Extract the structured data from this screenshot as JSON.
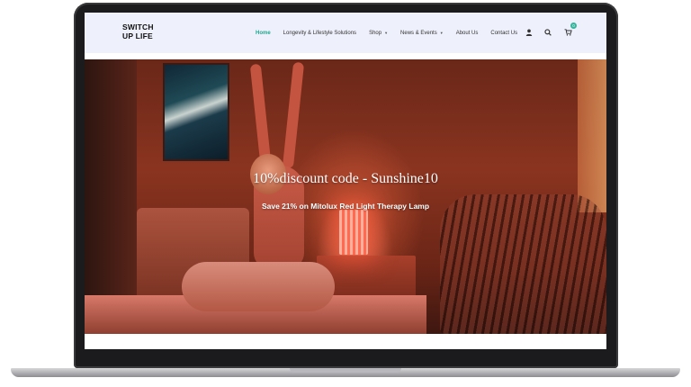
{
  "brand": {
    "logo_line1": "SWITCH",
    "logo_line2": "UP LIFE"
  },
  "nav": {
    "items": [
      {
        "label": "Home",
        "active": true
      },
      {
        "label": "Longevity & Lifestyle Solutions"
      },
      {
        "label": "Shop",
        "dropdown": true
      },
      {
        "label": "News & Events",
        "dropdown": true
      },
      {
        "label": "About Us"
      },
      {
        "label": "Contact Us"
      }
    ],
    "cart_count": "0",
    "icons": [
      "user-icon",
      "search-icon",
      "cart-icon"
    ]
  },
  "hero": {
    "title": "10%discount code - Sunshine10",
    "subtitle": "Save 21% on Mitolux Red Light Therapy Lamp"
  },
  "colors": {
    "accent": "#22a88f",
    "nav_bg": "#eef0fb",
    "badge": "#35b59e"
  }
}
